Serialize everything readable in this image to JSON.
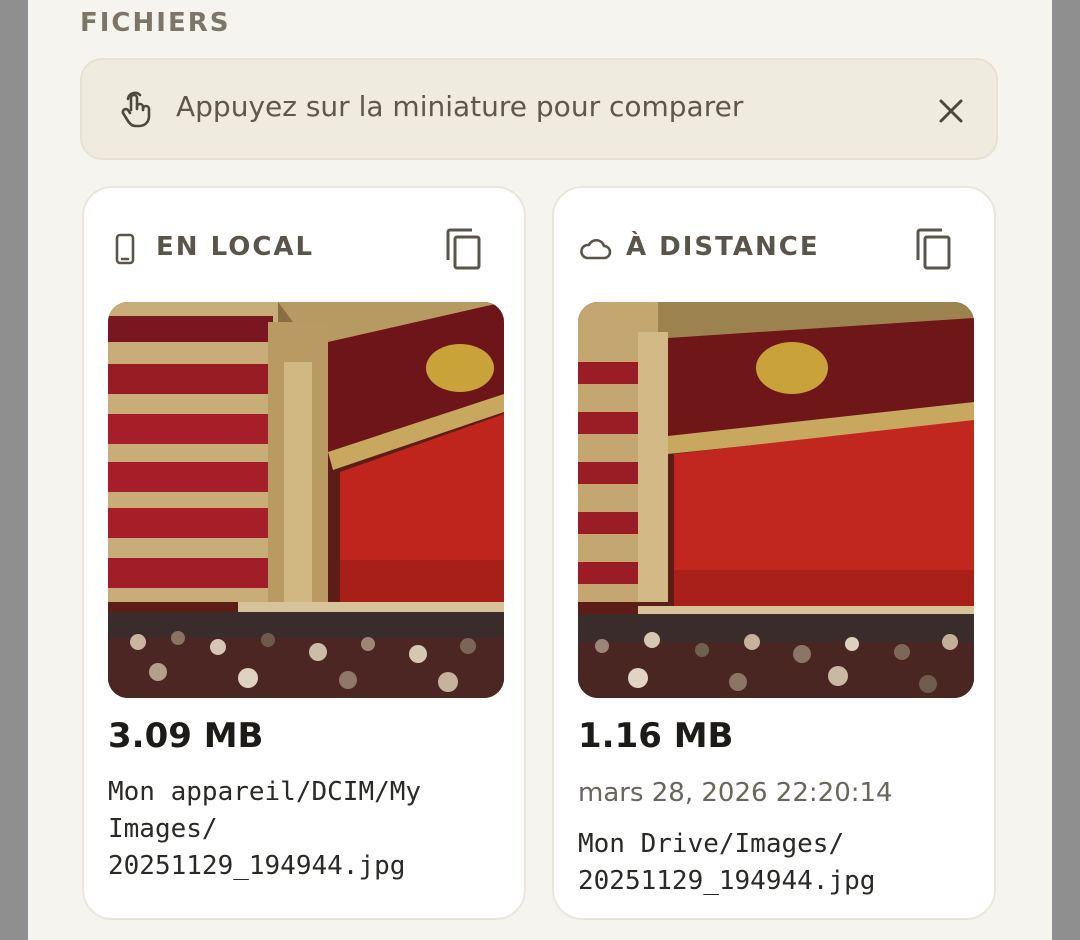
{
  "section": {
    "title": "FICHIERS"
  },
  "hint": {
    "icon": "touch-hand-icon",
    "text": "Appuyez sur la miniature pour comparer",
    "close_icon": "close-icon"
  },
  "local": {
    "icon": "phone-icon",
    "label": "EN LOCAL",
    "copy_icon": "copy-icon",
    "size": "3.09 MB",
    "path": "Mon appareil/DCIM/My\nImages/\n20251129_194944.jpg"
  },
  "remote": {
    "icon": "cloud-icon",
    "label": "À DISTANCE",
    "copy_icon": "copy-icon",
    "size": "1.16 MB",
    "date": "mars 28, 2026 22:20:14",
    "path": "Mon Drive/Images/\n20251129_194944.jpg"
  },
  "colors": {
    "background": "#8f8f8f",
    "sheet": "#f6f4ef",
    "hint_bg": "#f0ebdf",
    "card_bg": "#ffffff",
    "heading": "#7d7568",
    "text_dark": "#1d1b18"
  }
}
